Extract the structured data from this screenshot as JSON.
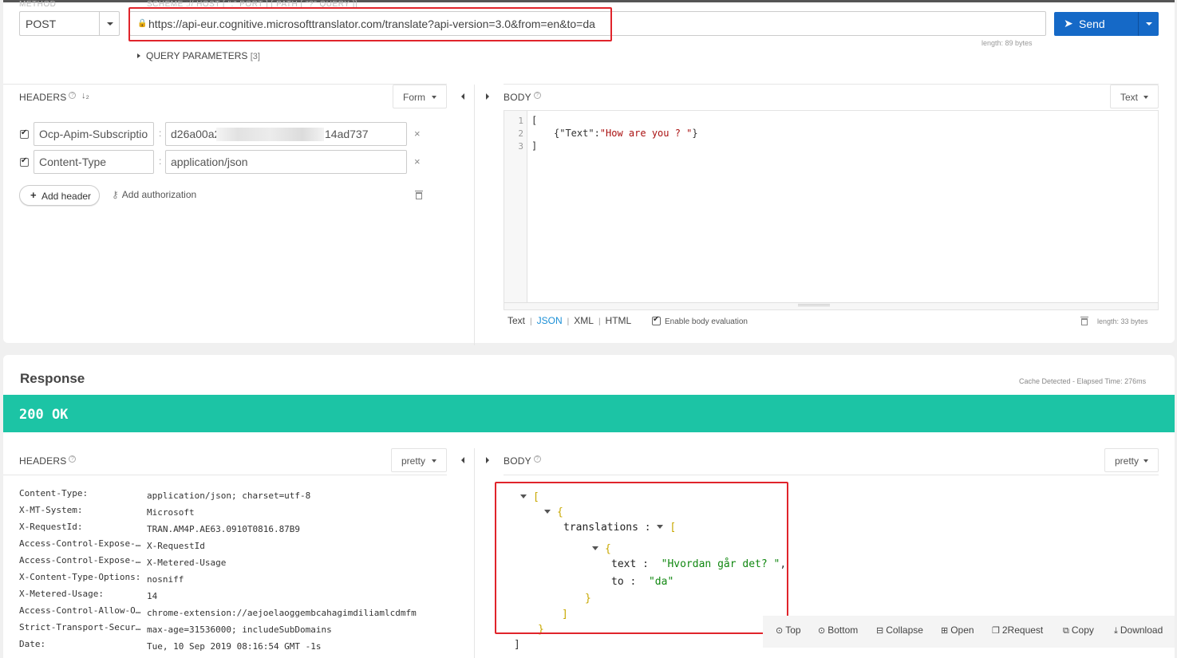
{
  "request": {
    "top_labels": {
      "method": "METHOD",
      "scheme": "SCHEME :// HOST [ \":\" PORT ] [ PATH [ \"?\" QUERY ]]"
    },
    "method": "POST",
    "url": "https://api-eur.cognitive.microsofttranslator.com/translate?api-version=3.0&from=en&to=da",
    "url_length": "length: 89 bytes",
    "send_label": "Send",
    "query_params_label": "QUERY PARAMETERS",
    "query_params_count": "[3]",
    "headers_label": "HEADERS",
    "headers_mode": "Form",
    "headers": [
      {
        "name": "Ocp-Apim-Subscriptio",
        "value_start": "d26a00a2",
        "value_end": "14ad737",
        "checked": true
      },
      {
        "name": "Content-Type",
        "value": "application/json",
        "checked": true
      }
    ],
    "add_header_label": "Add header",
    "add_auth_label": "Add authorization",
    "body_label": "BODY",
    "body_mode": "Text",
    "body_lines": {
      "line1": "[",
      "line2_key": "{\"Text\":",
      "line2_val": "\"How are you ? \"",
      "line2_end": "}",
      "line3": "]"
    },
    "line_numbers": [
      "1",
      "2",
      "3"
    ],
    "body_types": [
      "Text",
      "JSON",
      "XML",
      "HTML"
    ],
    "active_body_type": "JSON",
    "body_eval_label": "Enable body evaluation",
    "body_length": "length: 33 bytes"
  },
  "response": {
    "title": "Response",
    "meta": "Cache Detected - Elapsed Time: 276ms",
    "status": "200 OK",
    "status_color": "#1cc4a5",
    "headers_label": "HEADERS",
    "headers_mode": "pretty",
    "body_label": "BODY",
    "body_mode": "pretty",
    "headers": [
      {
        "k": "Content-Type:",
        "v": "application/json; charset=utf-8"
      },
      {
        "k": "X-MT-System:",
        "v": "Microsoft"
      },
      {
        "k": "X-RequestId:",
        "v": "TRAN.AM4P.AE63.0910T0816.87B9"
      },
      {
        "k": "Access-Control-Expose-…",
        "v": "X-RequestId"
      },
      {
        "k": "Access-Control-Expose-…",
        "v": "X-Metered-Usage"
      },
      {
        "k": "X-Content-Type-Options:",
        "v": "nosniff"
      },
      {
        "k": "X-Metered-Usage:",
        "v": "14"
      },
      {
        "k": "Access-Control-Allow-O…",
        "v": "chrome-extension://aejoelaoggembcahagimdiliamlcdmfm"
      },
      {
        "k": "Strict-Transport-Secur…",
        "v": "max-age=31536000; includeSubDomains"
      },
      {
        "k": "Date:",
        "v": "Tue, 10 Sep 2019 08:16:54 GMT -1s"
      }
    ],
    "json": {
      "open_arr": "[",
      "open_obj": "{",
      "translations_key": "translations",
      "colon": ":",
      "text_key": "text",
      "text_val": "\"Hvordan går det? \"",
      "comma": ",",
      "to_key": "to",
      "to_val": "\"da\"",
      "close_obj": "}",
      "close_arr": "]"
    },
    "toolbar": [
      "Top",
      "Bottom",
      "Collapse",
      "Open",
      "2Request",
      "Copy",
      "Download"
    ]
  }
}
